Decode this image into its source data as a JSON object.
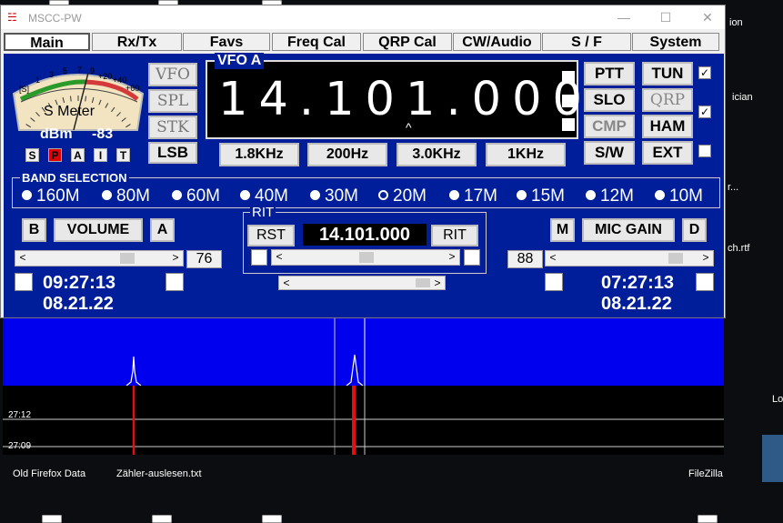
{
  "window": {
    "title": "MSCC-PW",
    "controls": [
      "—",
      "☐",
      "✕"
    ]
  },
  "tabs": [
    "Main",
    "Rx/Tx",
    "Favs",
    "Freq Cal",
    "QRP Cal",
    "CW/Audio",
    "S / F",
    "System"
  ],
  "meter": {
    "scale_labels": [
      "[S]",
      "1",
      "3",
      "5",
      "7",
      "9",
      "+20",
      "+40",
      "+60"
    ],
    "title": "S Meter",
    "dbm_label": "dBm",
    "dbm_value": "-83",
    "mode_letters": [
      "S",
      "P",
      "A",
      "I",
      "T"
    ],
    "active_mode": "P"
  },
  "left_buttons": [
    "VFO",
    "SPL",
    "STK",
    "LSB"
  ],
  "vfo": {
    "label": "VFO A",
    "frequency": "14.101.000",
    "cursor": "^"
  },
  "filter_buttons": [
    "1.8KHz",
    "200Hz",
    "3.0KHz",
    "1KHz"
  ],
  "right_buttons": [
    "PTT",
    "SLO",
    "CMP",
    "S/W",
    "TUN",
    "QRP",
    "HAM",
    "EXT"
  ],
  "right_checks": [
    "✓",
    "✓",
    ""
  ],
  "band_selection": {
    "title": "BAND SELECTION",
    "bands": [
      "160M",
      "80M",
      "60M",
      "40M",
      "30M",
      "20M",
      "17M",
      "15M",
      "12M",
      "10M"
    ],
    "selected": "20M"
  },
  "volume": {
    "b_label": "B",
    "label": "VOLUME",
    "a_label": "A",
    "value": "76",
    "level": 0.72
  },
  "rit": {
    "title": "RIT",
    "rst": "RST",
    "freq": "14.101.000",
    "rit_btn": "RIT"
  },
  "mic": {
    "m_label": "M",
    "label": "MIC GAIN",
    "d_label": "D",
    "value": "88",
    "level": 0.86
  },
  "clock_left": {
    "time": "09:27:13",
    "date": "08.21.22"
  },
  "clock_right": {
    "time": "07:27:13",
    "date": "08.21.22"
  },
  "waterfall": {
    "timestamps": [
      "27:12",
      "27:09"
    ]
  },
  "desktop": {
    "labels": [
      "Old Firefox Data",
      "Zähler-auslesen.txt",
      "FileZilla",
      "ion",
      "ician",
      "r...",
      "ch.rtf",
      "Lo"
    ]
  },
  "scroll_arrows": {
    "left": "<",
    "right": ">"
  }
}
